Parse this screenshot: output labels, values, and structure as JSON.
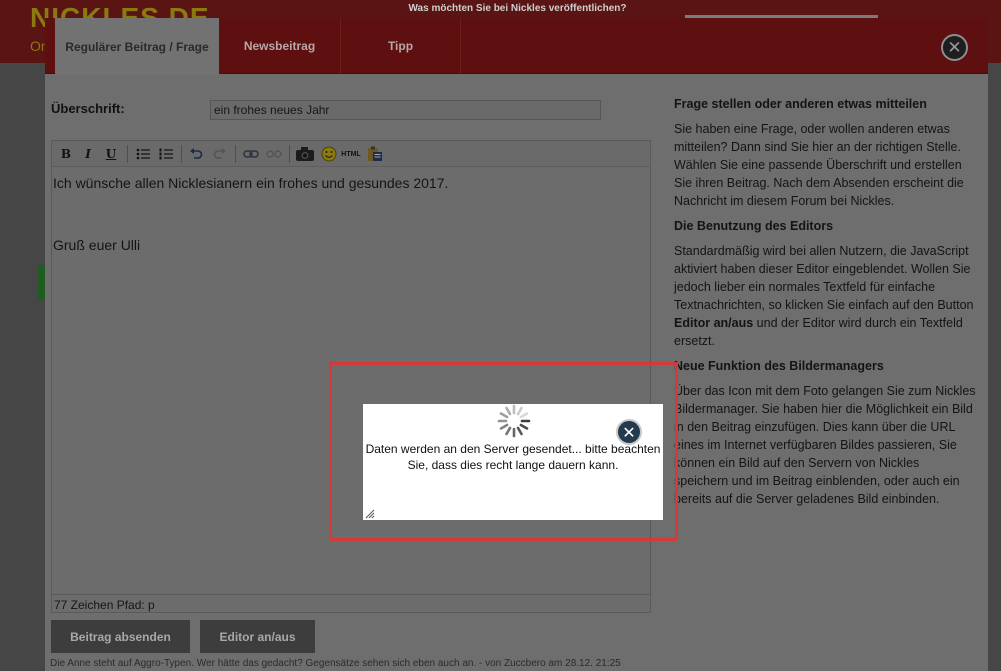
{
  "background": {
    "logo_text": "NICKLES.DE",
    "logo_sub": "On",
    "topbar_text": "Was möchten Sie bei Nickles veröffentlichen?",
    "footer_text": "Die Anne steht auf Aggro-Typen. Wer hätte das gedacht? Gegensätze sehen sich eben auch an. - von Zuccbero am 28.12. 21:25"
  },
  "modal": {
    "tabs": [
      {
        "label": "Regulärer Beitrag / Frage",
        "active": true
      },
      {
        "label": "Newsbeitrag",
        "active": false
      },
      {
        "label": "Tipp",
        "active": false
      }
    ],
    "close_icon": "close-icon",
    "heading_label": "Überschrift:",
    "heading_value": "ein frohes neues Jahr",
    "toolbar": {
      "bold": "B",
      "italic": "I",
      "underline": "U",
      "html": "HTML"
    },
    "editor": {
      "line1": "Ich wünsche allen Nicklesianern ein frohes und gesundes 2017.",
      "line2": "Gruß euer Ulli",
      "status": "77 Zeichen Pfad: p"
    },
    "buttons": {
      "submit": "Beitrag absenden",
      "editor_toggle": "Editor an/aus"
    },
    "help": {
      "h1": "Frage stellen oder anderen etwas mitteilen",
      "p1": "Sie haben eine Frage, oder wollen anderen etwas mitteilen? Dann sind Sie hier an der richtigen Stelle. Wählen Sie eine passende Überschrift und erstellen Sie ihren Beitrag. Nach dem Absenden erscheint die Nachricht im diesem Forum bei Nickles.",
      "h2": "Die Benutzung des Editors",
      "p2_before": "Standardmäßig wird bei allen Nutzern, die JavaScript aktiviert haben dieser Editor eingeblendet. Wollen Sie jedoch lieber ein normales Textfeld für einfache Textnachrichten, so klicken Sie einfach auf den Button ",
      "p2_bold": "Editor an/aus",
      "p2_after": " und der Editor wird durch ein Textfeld ersetzt.",
      "h3": "Neue Funktion des Bildermanagers",
      "p3": "Über das Icon mit dem Foto gelangen Sie zum Nickles Bildermanager. Sie haben hier die Möglichkeit ein Bild in den Beitrag einzufügen. Dies kann über die URL eines im Internet verfügbaren Bildes passieren, Sie können ein Bild auf den Servern von Nickles speichern und im Beitrag einblenden, oder auch ein bereits auf die Server geladenes Bild einbinden."
    }
  },
  "popup": {
    "message_line1": "Daten werden an den Server gesendet... bitte beachten",
    "message_line2": "Sie, dass dies recht lange dauern kann.",
    "spinner_icon": "loading-spinner-icon",
    "close_icon": "close-icon",
    "highlight_color": "#d33a3a"
  }
}
